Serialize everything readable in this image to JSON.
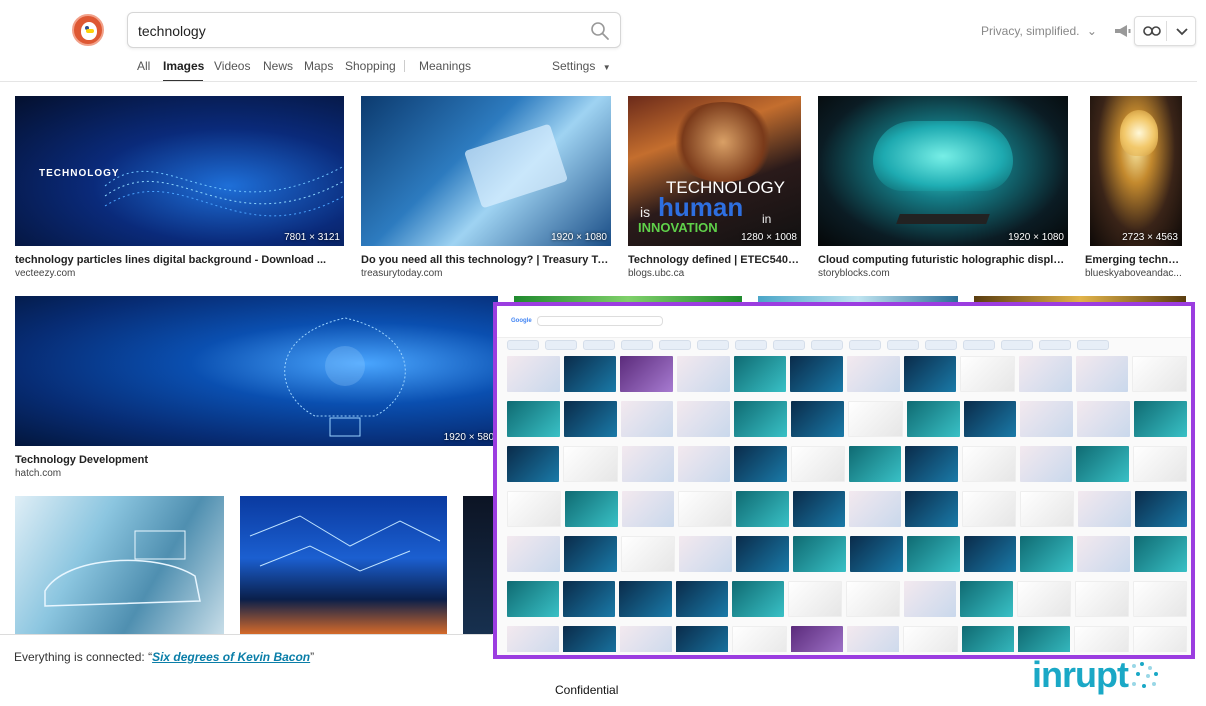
{
  "search": {
    "query": "technology"
  },
  "header": {
    "privacy_text": "Privacy, simplified."
  },
  "tabs": [
    {
      "label": "All"
    },
    {
      "label": "Images"
    },
    {
      "label": "Videos"
    },
    {
      "label": "News"
    },
    {
      "label": "Maps"
    },
    {
      "label": "Shopping"
    },
    {
      "label": "Meanings"
    },
    {
      "label": "Settings"
    }
  ],
  "results": [
    {
      "size": "7801 × 3121",
      "title": "technology particles lines digital background - Download ...",
      "source": "vecteezy.com",
      "overlay_text": "TECHNOLOGY"
    },
    {
      "size": "1920 × 1080",
      "title": "Do you need all this technology? | Treasury Today",
      "source": "treasurytoday.com"
    },
    {
      "size": "1280 × 1008",
      "title": "Technology defined | ETEC540: T...",
      "source": "blogs.ubc.ca",
      "overlay_lines": [
        "TECHNOLOGY",
        "is",
        "human",
        "INNOVATION",
        "in"
      ]
    },
    {
      "size": "1920 × 1080",
      "title": "Cloud computing futuristic holographic display h...",
      "source": "storyblocks.com"
    },
    {
      "size": "2723 × 4563",
      "title": "Emerging technol...",
      "source": "blueskyaboveandac..."
    },
    {
      "size": "1920 × 580",
      "title": "Technology Development",
      "source": "hatch.com"
    }
  ],
  "overlay": {
    "logo": "Google",
    "border_color": "#9b3de0"
  },
  "footer": {
    "note_prefix": "Everything is connected: “",
    "note_link": "Six degrees of Kevin Bacon",
    "note_suffix": "”",
    "confidential": "Confidential",
    "brand": "inrupt"
  },
  "colors": {
    "accent": "#1aa8c6",
    "ddg_orange": "#de5833",
    "highlight_border": "#9b3de0"
  }
}
